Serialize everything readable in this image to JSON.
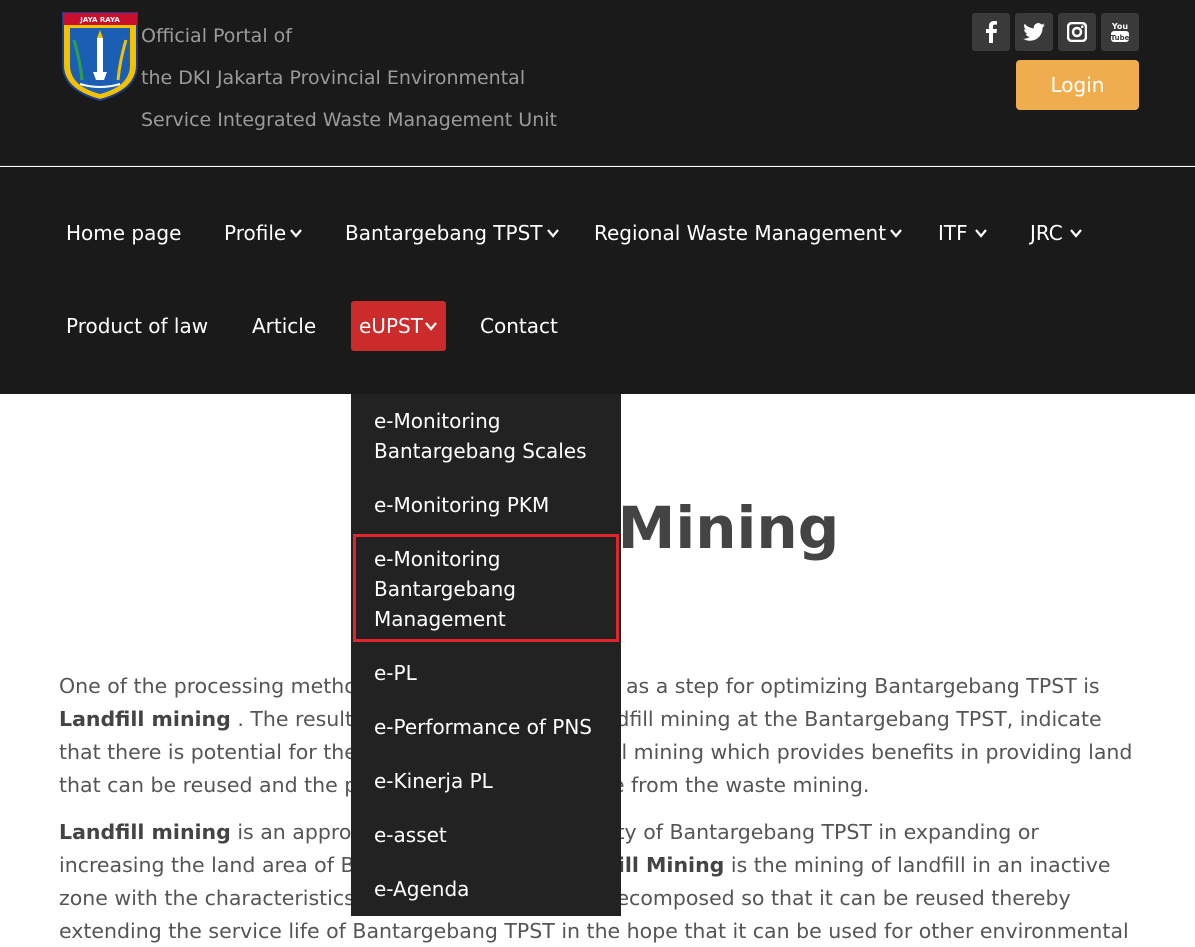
{
  "header": {
    "title_lines": [
      "Official Portal of",
      "the DKI Jakarta Provincial Environmental",
      "Service Integrated Waste Management Unit"
    ],
    "logo_text": "JAYA RAYA",
    "login_label": "Login",
    "social_icons": [
      "facebook-icon",
      "twitter-icon",
      "instagram-icon",
      "youtube-icon"
    ],
    "youtube_glyph": "You\nTube"
  },
  "nav": {
    "row1": [
      "Home page",
      "Profile",
      "Bantargebang TPST",
      "Regional Waste Management",
      "ITF",
      "JRC"
    ],
    "row2": [
      "Product of law",
      "Article",
      "eUPST",
      "Contact"
    ],
    "active": "eUPST",
    "active_color": "#cc2b2b"
  },
  "dropdown": {
    "items": [
      "e-Monitoring Bantargebang Scales",
      "e-Monitoring PKM",
      "e-Monitoring Bantargebang Management",
      "e-PL",
      "e-Performance of PNS",
      "e-Kinerja PL",
      "e-asset",
      "e-Agenda"
    ],
    "highlighted": "e-Monitoring Bantargebang Management",
    "highlight_color": "#e0242b"
  },
  "main": {
    "title": "Landfill Mining",
    "p1": {
      "t1": "One of the processing methods that will be carried out as a step for optimizing Bantargebang TPST is ",
      "b1": "Landfill mining",
      "t2": " . The results of a study related to landfill mining at the Bantargebang TPST, indicate that there is potential for the implementation of landfill mining which provides benefits in providing land that can be reused and the potential for utilizing waste from the waste mining."
    },
    "p2": {
      "b1": "Landfill mining",
      "t1": " is an approach to develop the capacity of Bantargebang TPST in expanding or increasing the land area of Bantargebang TPST. ",
      "b2": "Landfill Mining",
      "t2": " is the mining of landfill in an inactive zone with the characteristics of waste that has been decomposed so that it can be reused thereby extending the service life of Bantargebang TPST in the hope that it can be used for other environmental purposes."
    }
  },
  "colors": {
    "header_bg": "#1a1a1a",
    "login_bg": "#f0ad4e",
    "dropdown_bg": "#222222"
  }
}
